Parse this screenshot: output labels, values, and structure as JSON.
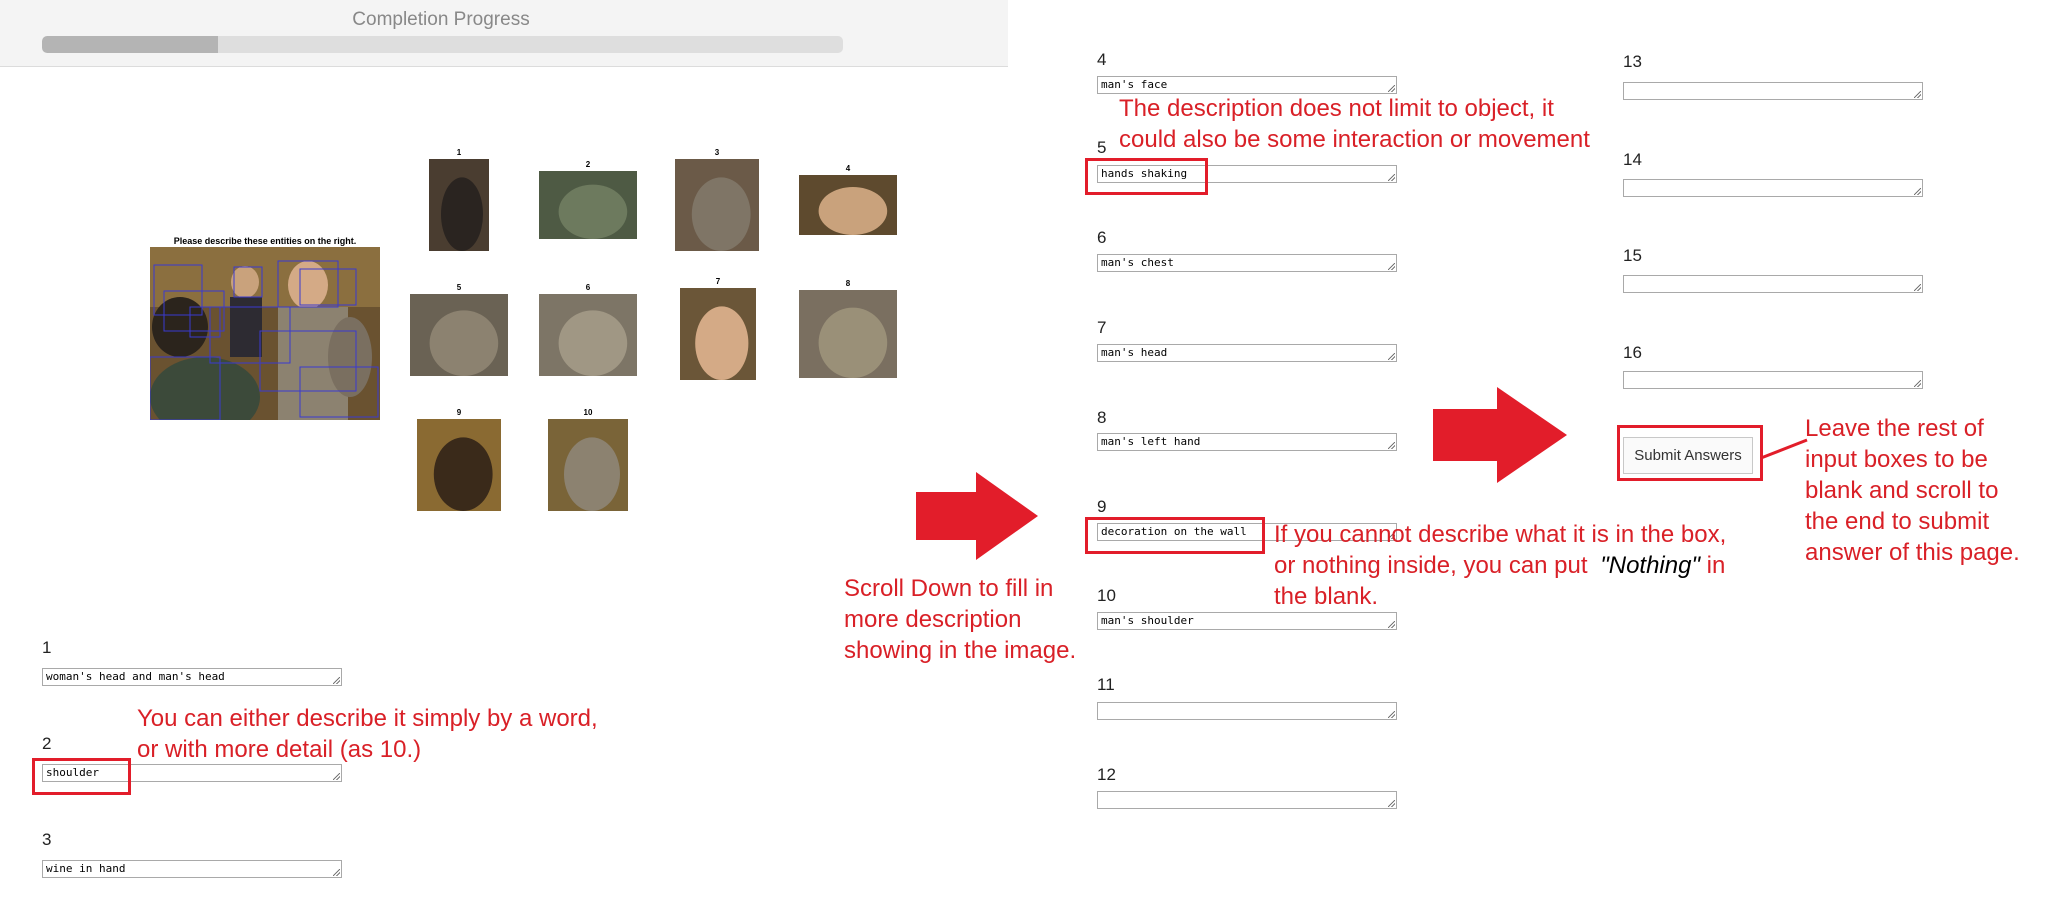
{
  "progress": {
    "title": "Completion Progress",
    "fraction": 0.22
  },
  "task": {
    "caption": "Please describe these entities on the right.",
    "thumbnails": [
      "1",
      "2",
      "3",
      "4",
      "5",
      "6",
      "7",
      "8",
      "9",
      "10"
    ]
  },
  "fields": [
    {
      "label": "1",
      "value": "woman's head and man's head"
    },
    {
      "label": "2",
      "value": "shoulder"
    },
    {
      "label": "3",
      "value": "wine in hand"
    },
    {
      "label": "4",
      "value": "man's face"
    },
    {
      "label": "5",
      "value": "hands shaking"
    },
    {
      "label": "6",
      "value": "man's chest"
    },
    {
      "label": "7",
      "value": "man's head"
    },
    {
      "label": "8",
      "value": "man's left hand"
    },
    {
      "label": "9",
      "value": "decoration on the wall"
    },
    {
      "label": "10",
      "value": "man's shoulder"
    },
    {
      "label": "11",
      "value": ""
    },
    {
      "label": "12",
      "value": ""
    },
    {
      "label": "13",
      "value": ""
    },
    {
      "label": "14",
      "value": ""
    },
    {
      "label": "15",
      "value": ""
    },
    {
      "label": "16",
      "value": ""
    }
  ],
  "submit_label": "Submit Answers",
  "annotations": {
    "detail_line1": "You can either describe it simply by a word,",
    "detail_line2": "or with more detail (as 10.)",
    "scroll_line1": "Scroll Down to fill in",
    "scroll_line2": "more description",
    "scroll_line3": "showing in the image.",
    "interaction_line1": "The description does not limit to object, it",
    "interaction_line2": "could also be some interaction or movement",
    "nothing_line1": "If you cannot describe what it is in the box,",
    "nothing_line2_pre": "or nothing inside, you can put",
    "nothing_word": "\"Nothing\"",
    "nothing_line2_post": "in",
    "nothing_line3": "the blank.",
    "rest_line1": "Leave the rest of",
    "rest_line2": "input boxes to be",
    "rest_line3": "blank and scroll to",
    "rest_line4": "the end to submit",
    "rest_line5": "answer of this page."
  },
  "colors": {
    "annotation": "#d92027",
    "progress_fill": "#b4b4b4",
    "progress_track": "#dedede"
  },
  "icons": [
    "arrow-right-icon",
    "arrow-right-icon",
    "arrow-right-icon"
  ]
}
